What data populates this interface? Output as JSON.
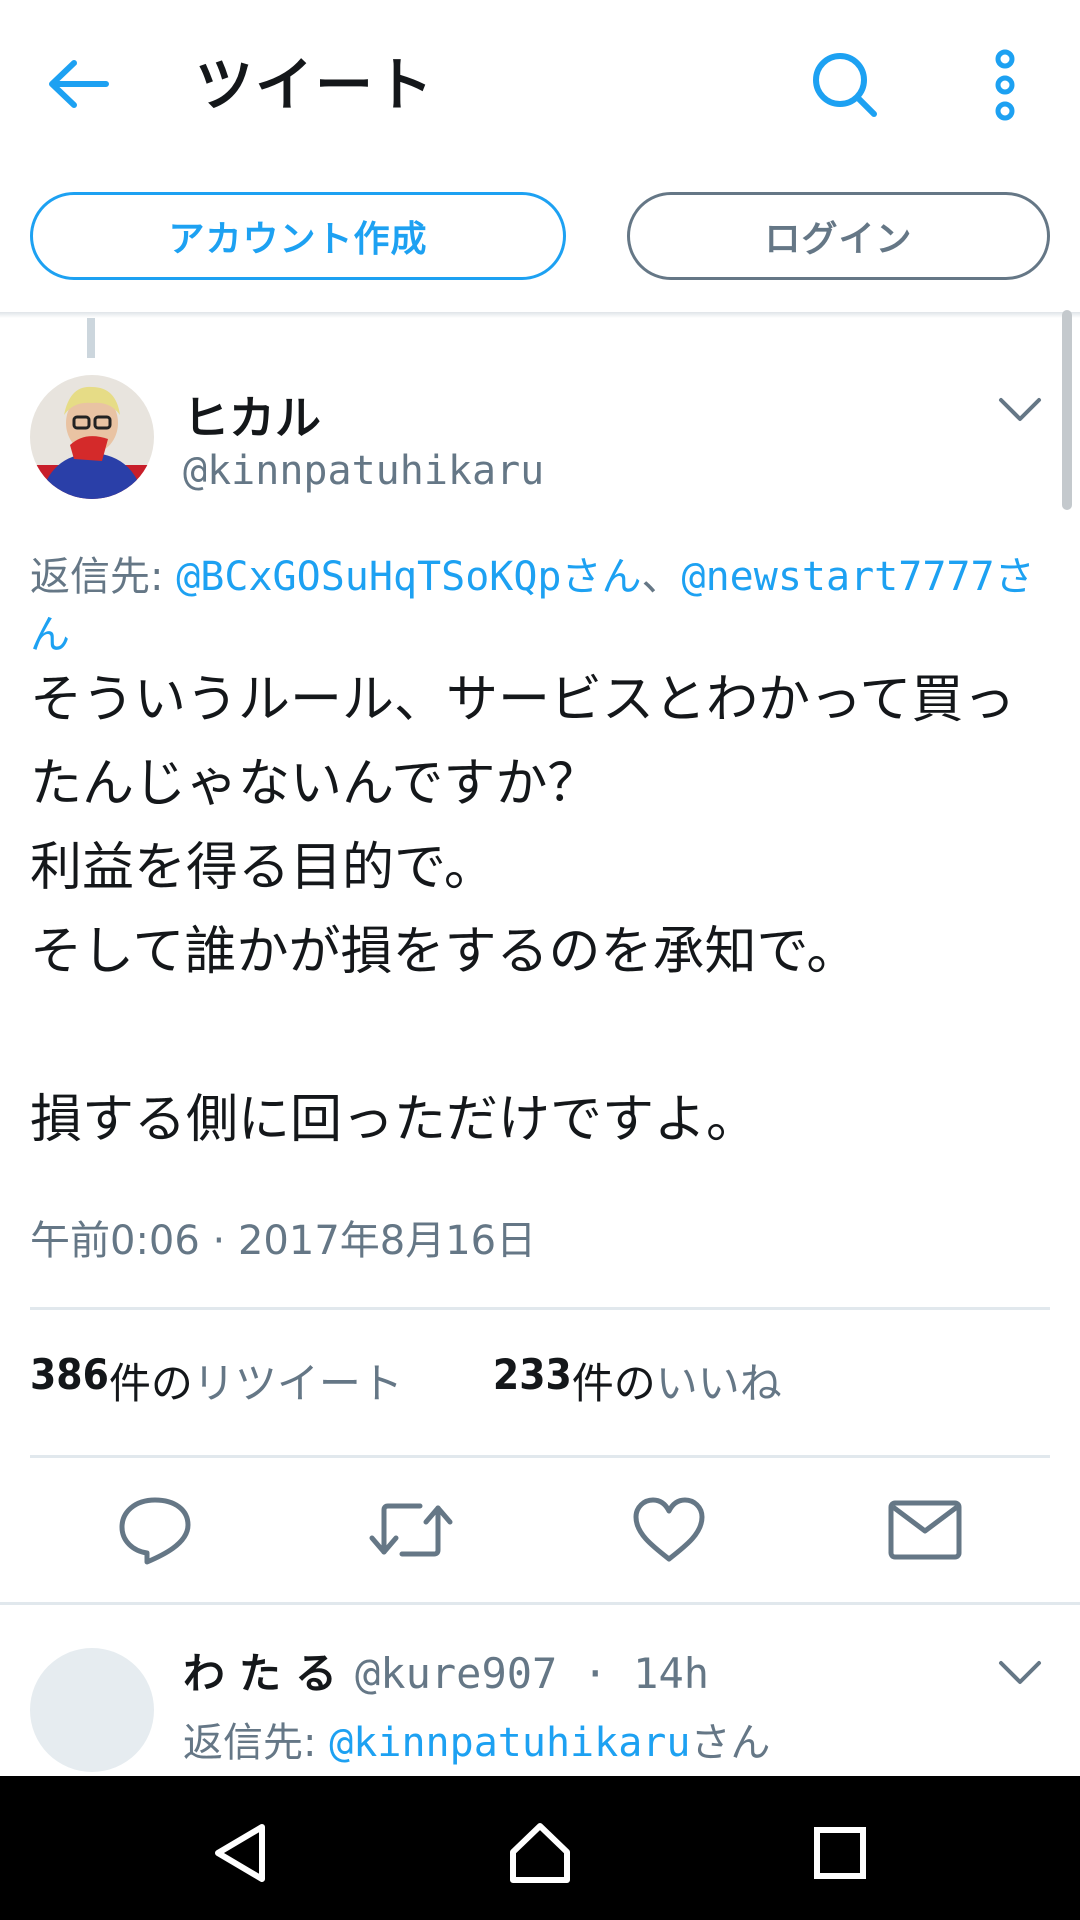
{
  "header": {
    "title": "ツイート",
    "back_icon": "arrow-left-icon",
    "search_icon": "search-icon",
    "more_icon": "more-vertical-icon"
  },
  "account": {
    "signup_label": "アカウント作成",
    "login_label": "ログイン"
  },
  "tweet": {
    "author_name": "ヒカル",
    "author_handle": "@kinnpatuhikaru",
    "reply_prefix": "返信先: ",
    "reply_mention_1": "@BCxGOSuHqTSoKQpさん",
    "reply_separator": "、",
    "reply_mention_2": "@newstart7777さん",
    "text": "そういうルール、サービスとわかって買ったんじゃないんですか？\n利益を得る目的で。\nそして誰かが損をするのを承知で。\n\n損する側に回っただけですよ。",
    "timestamp": "午前0:06 · 2017年8月16日",
    "retweet_count": "386",
    "retweet_unit": "件の",
    "retweet_label": "リツイート",
    "like_count": "233",
    "like_unit": "件の",
    "like_label": "いいね"
  },
  "actions": [
    "reply-icon",
    "retweet-icon",
    "like-icon",
    "share-mail-icon"
  ],
  "reply_tweet": {
    "author_name": "わたる",
    "meta": "@kure907 · 14h",
    "reply_prefix": "返信先: ",
    "reply_mention": "@kinnpatuhikaru",
    "reply_suffix": "さん"
  },
  "nav": [
    "back-triangle-icon",
    "home-icon",
    "recents-square-icon"
  ],
  "colors": {
    "accent": "#1da1f2",
    "secondary_text": "#657786",
    "primary_text": "#14171a",
    "divider": "#e1e8ed"
  }
}
